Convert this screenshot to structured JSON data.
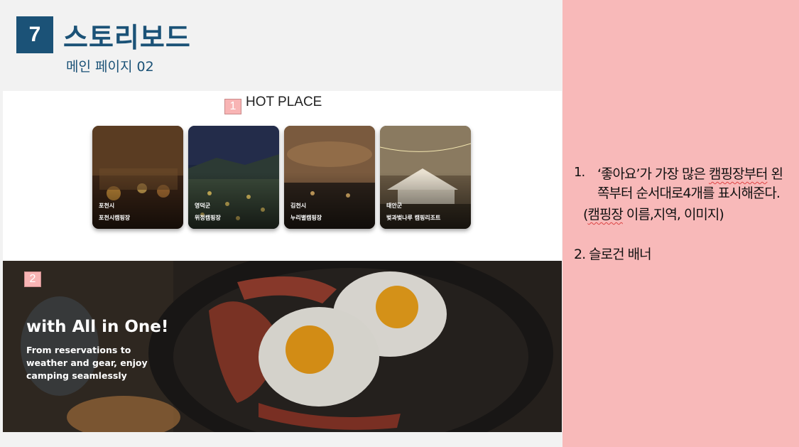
{
  "header": {
    "slide_number": "7",
    "title": "스토리보드",
    "subtitle": "메인 페이지 02"
  },
  "hot_place": {
    "marker": "1",
    "title": "HOT PLACE",
    "cards": [
      {
        "region": "포천시",
        "name": "포천시캠핑장"
      },
      {
        "region": "영덕군",
        "name": "위정캠핑장"
      },
      {
        "region": "김천시",
        "name": "누리별캠핑장"
      },
      {
        "region": "태안군",
        "name": "벚과벚나루 캠핑리조트"
      }
    ]
  },
  "banner": {
    "marker": "2",
    "title": "with All in One!",
    "text": "From reservations to weather and gear, enjoy camping seamlessly"
  },
  "notes": {
    "item1_num": "1.",
    "item1_pre": "‘좋아요’가 가장 많은 ",
    "item1_squiggle": "캠핑장부터",
    "item1_post": " 왼쪽부터 순서대로4개를 표시해준다.",
    "item1_extra_open": "(",
    "item1_extra_squiggle": "캠핑장",
    "item1_extra_rest": " 이름,지역, 이미지)",
    "item2": "2. 슬로건 배너"
  },
  "colors": {
    "accent": "#1b5277",
    "side_panel": "#f8b9b9",
    "marker": "#f8b4b4"
  }
}
